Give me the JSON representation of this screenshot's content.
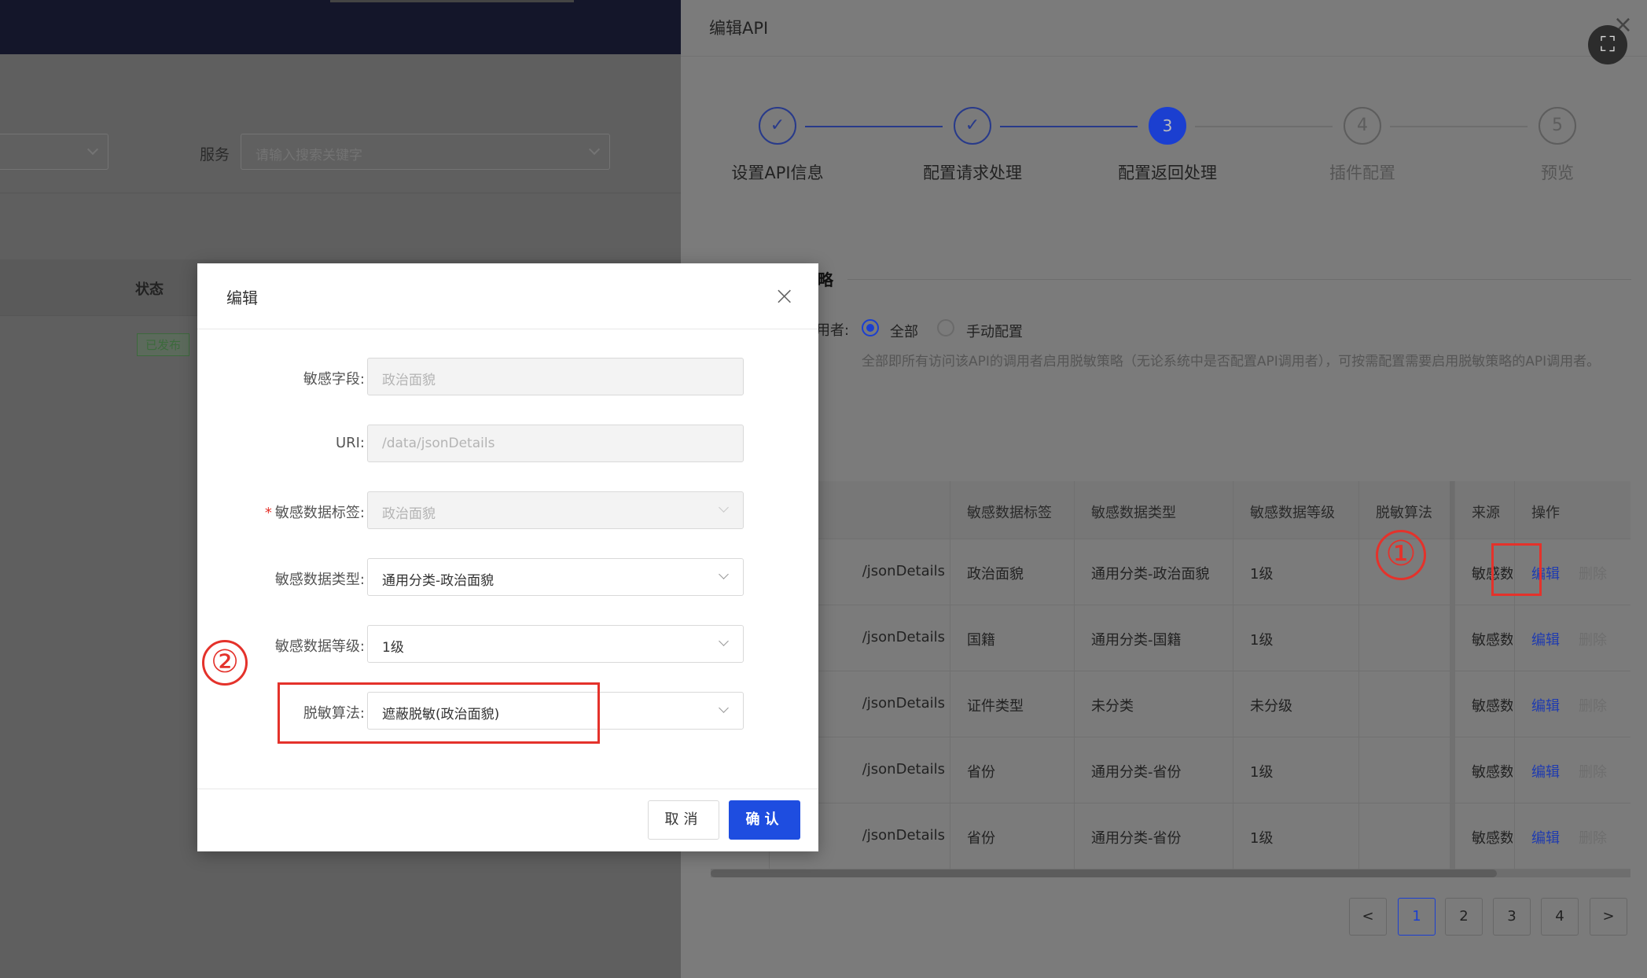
{
  "background_page": {
    "service_label": "服务",
    "service_placeholder": "请输入搜索关键字",
    "status_header": "状态",
    "status_badge": "已发布"
  },
  "drawer": {
    "title": "编辑API",
    "close_icon": "close-icon",
    "fullscreen_icon": "fullscreen-exit-icon",
    "steps": [
      {
        "number": "✓",
        "label": "设置API信息",
        "state": "done"
      },
      {
        "number": "✓",
        "label": "配置请求处理",
        "state": "done"
      },
      {
        "number": "3",
        "label": "配置返回处理",
        "state": "active"
      },
      {
        "number": "4",
        "label": "插件配置",
        "state": "todo"
      },
      {
        "number": "5",
        "label": "预览",
        "state": "todo"
      }
    ],
    "section_title": "略",
    "caller_label": "用者:",
    "radio_all": "全部",
    "radio_manual": "手动配置",
    "hint": "全部即所有访问该API的调用者启用脱敏策略（无论系统中是否配置API调用者），可按需配置需要启用脱敏策略的API调用者。",
    "table": {
      "headers": [
        "",
        "敏感数据标签",
        "敏感数据类型",
        "敏感数据等级",
        "脱敏算法",
        "来源",
        "操作"
      ],
      "rows": [
        {
          "uri": "/jsonDetails",
          "tag": "政治面貌",
          "type": "通用分类-政治面貌",
          "level": "1级",
          "algo": "",
          "source": "敏感数",
          "edit": "编辑",
          "delete": "删除"
        },
        {
          "uri": "/jsonDetails",
          "tag": "国籍",
          "type": "通用分类-国籍",
          "level": "1级",
          "algo": "",
          "source": "敏感数",
          "edit": "编辑",
          "delete": "删除"
        },
        {
          "uri": "/jsonDetails",
          "tag": "证件类型",
          "type": "未分类",
          "level": "未分级",
          "algo": "",
          "source": "敏感数",
          "edit": "编辑",
          "delete": "删除"
        },
        {
          "uri": "/jsonDetails",
          "tag": "省份",
          "type": "通用分类-省份",
          "level": "1级",
          "algo": "",
          "source": "敏感数",
          "edit": "编辑",
          "delete": "删除"
        },
        {
          "uri": "/jsonDetails",
          "tag": "省份",
          "type": "通用分类-省份",
          "level": "1级",
          "algo": "",
          "source": "敏感数",
          "edit": "编辑",
          "delete": "删除"
        }
      ]
    },
    "pagination": {
      "prev": "<",
      "pages": [
        "1",
        "2",
        "3",
        "4"
      ],
      "current": "1",
      "next": ">"
    },
    "annotation_1": "①"
  },
  "modal": {
    "title": "编辑",
    "fields": {
      "sensitive_field": {
        "label": "敏感字段:",
        "value": "政治面貌"
      },
      "uri": {
        "label": "URI:",
        "value": "/data/jsonDetails"
      },
      "data_tag": {
        "required_mark": "*",
        "label": "敏感数据标签:",
        "value": "政治面貌"
      },
      "data_type": {
        "label": "敏感数据类型:",
        "value": "通用分类-政治面貌"
      },
      "data_level": {
        "label": "敏感数据等级:",
        "value": "1级"
      },
      "algorithm": {
        "label": "脱敏算法:",
        "value": "遮蔽脱敏(政治面貌)"
      }
    },
    "cancel_label": "取消",
    "ok_label": "确认",
    "annotation_2": "②"
  },
  "colors": {
    "primary": "#1e4de0",
    "annotation_red": "#e4322b"
  }
}
